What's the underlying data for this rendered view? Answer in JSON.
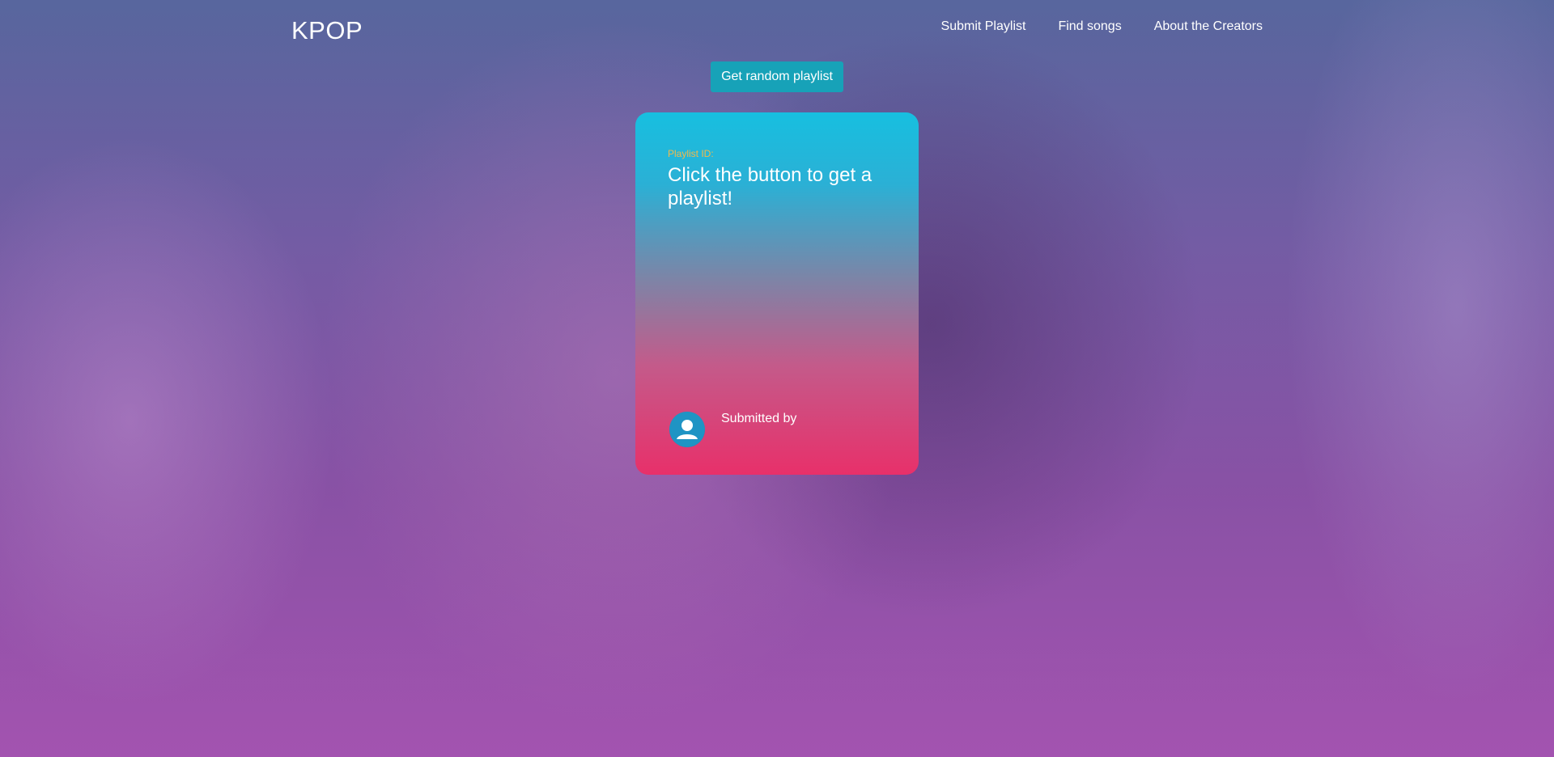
{
  "navbar": {
    "brand": "KPOP",
    "links": [
      {
        "label": "Submit Playlist"
      },
      {
        "label": "Find songs"
      },
      {
        "label": "About the Creators"
      }
    ]
  },
  "actions": {
    "random_playlist_label": "Get random playlist"
  },
  "card": {
    "playlist_id_label": "Playlist ID:",
    "title": "Click the button to get a playlist!",
    "submitted_by_label": "Submitted by",
    "avatar_icon": "user-avatar-icon"
  },
  "colors": {
    "button": "#17a2b8",
    "card_top": "#17bfe0",
    "card_bottom": "#e8306a",
    "playlist_id_label": "#f2b94a"
  }
}
